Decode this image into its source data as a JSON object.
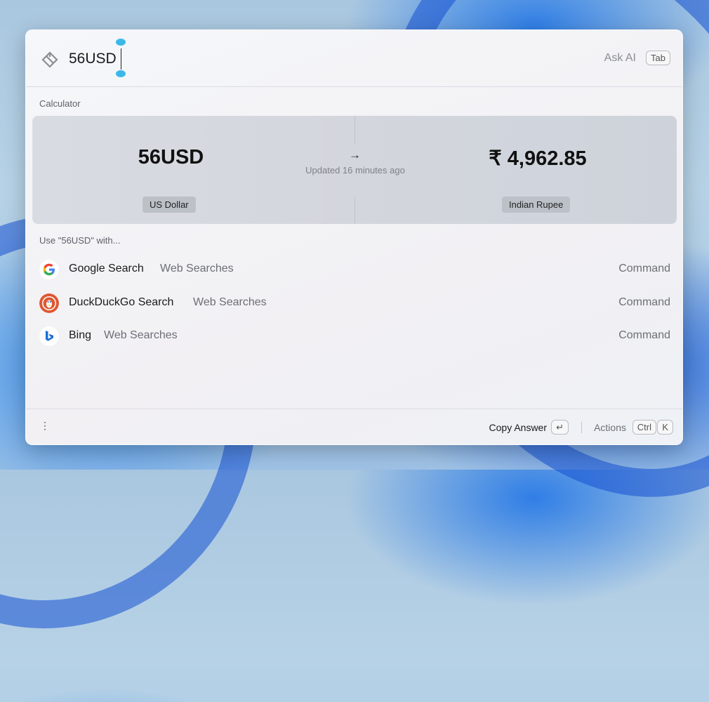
{
  "search": {
    "query": "56USD",
    "ask_ai_label": "Ask AI",
    "tab_key": "Tab"
  },
  "calculator": {
    "section_label": "Calculator",
    "from_value": "56USD",
    "to_value": "₹ 4,962.85",
    "arrow": "→",
    "updated": "Updated 16 minutes ago",
    "from_currency": "US Dollar",
    "to_currency": "Indian Rupee"
  },
  "use_with": {
    "label": "Use \"56USD\" with...",
    "items": [
      {
        "title": "Google Search",
        "subtitle": "Web Searches",
        "action": "Command",
        "icon": "google-icon"
      },
      {
        "title": "DuckDuckGo Search",
        "subtitle": "Web Searches",
        "action": "Command",
        "icon": "duckduckgo-icon"
      },
      {
        "title": "Bing",
        "subtitle": "Web Searches",
        "action": "Command",
        "icon": "bing-icon"
      }
    ]
  },
  "footer": {
    "menu_icon": "⋮",
    "copy_answer": "Copy Answer",
    "enter_key": "↵",
    "actions": "Actions",
    "ctrl_key": "Ctrl",
    "k_key": "K"
  },
  "colors": {
    "accent": "#3bb8ea",
    "card": "#d3d6dc",
    "tag": "#bcc0c7"
  }
}
